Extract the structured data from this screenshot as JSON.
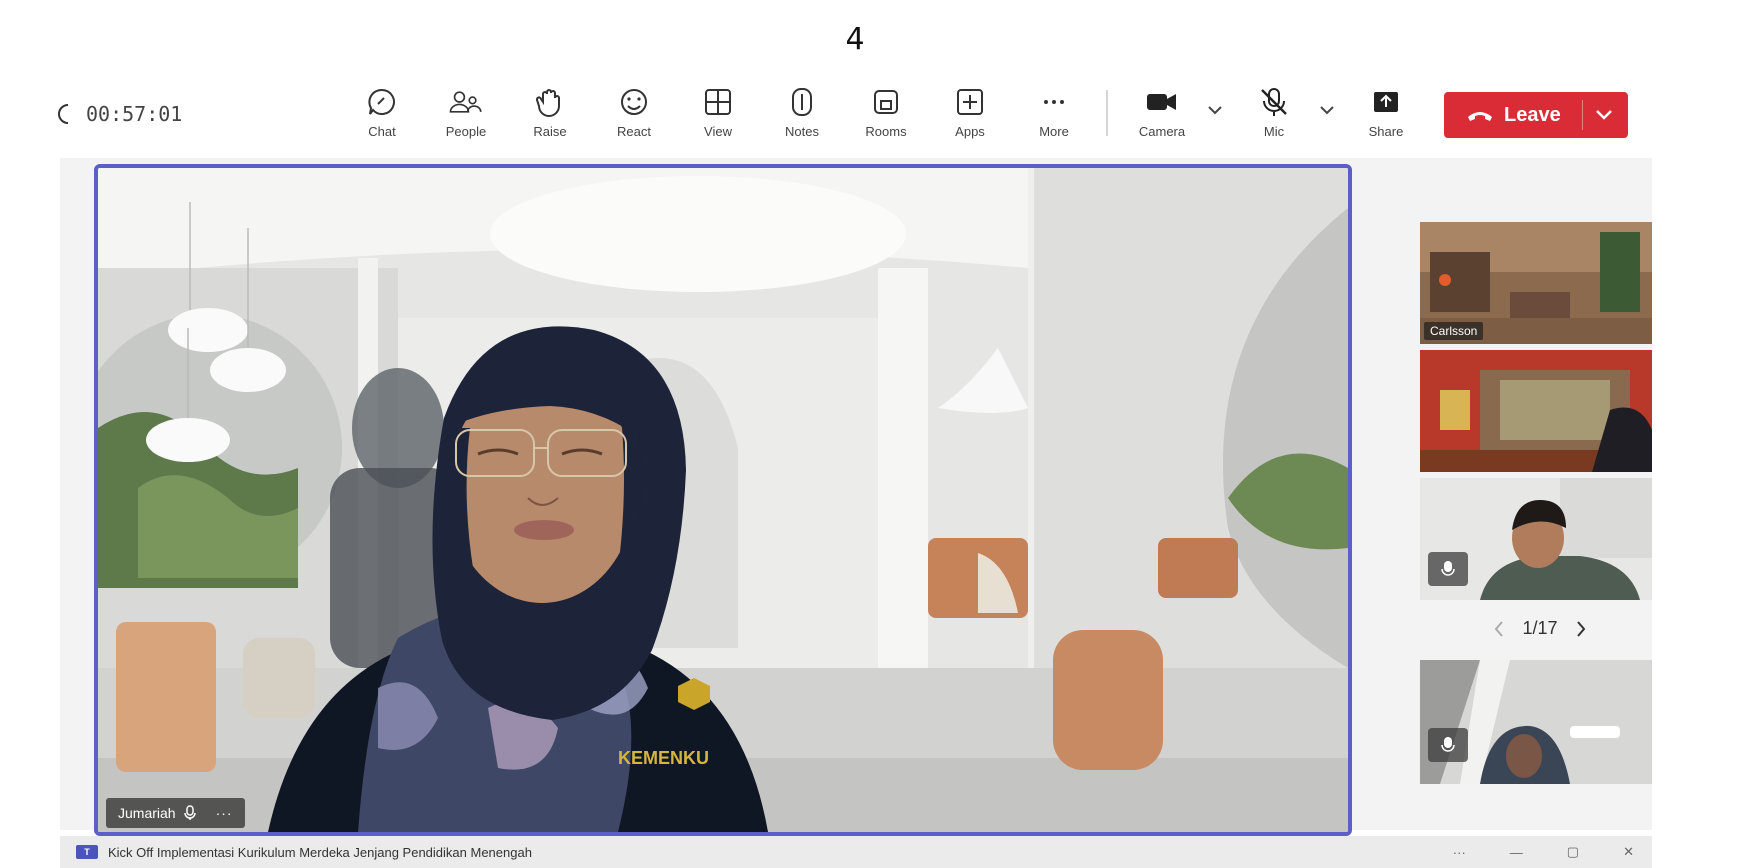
{
  "page_number": "4",
  "toolbar": {
    "timer": "00:57:01",
    "items": [
      {
        "label": "Chat",
        "icon": "chat-icon"
      },
      {
        "label": "People",
        "icon": "people-icon"
      },
      {
        "label": "Raise",
        "icon": "raise-hand-icon"
      },
      {
        "label": "React",
        "icon": "react-icon"
      },
      {
        "label": "View",
        "icon": "view-icon"
      },
      {
        "label": "Notes",
        "icon": "notes-icon"
      },
      {
        "label": "Rooms",
        "icon": "rooms-icon"
      },
      {
        "label": "Apps",
        "icon": "apps-icon"
      },
      {
        "label": "More",
        "icon": "more-icon"
      },
      {
        "label": "Camera",
        "icon": "camera-icon"
      },
      {
        "label": "Mic",
        "icon": "mic-off-icon"
      },
      {
        "label": "Share",
        "icon": "share-icon"
      }
    ],
    "leave_label": "Leave"
  },
  "main_video": {
    "participant_name": "Jumariah",
    "more_label": "···",
    "shirt_text": "KEMENKU"
  },
  "thumbnails": [
    {
      "label": "Carlsson"
    },
    {
      "label": ""
    },
    {
      "label": ""
    },
    {
      "label": ""
    }
  ],
  "pager": {
    "text": "1/17"
  },
  "statusbar": {
    "app_badge": "T",
    "title": "Kick Off Implementasi Kurikulum Merdeka Jenjang Pendidikan Menengah",
    "controls": [
      "···",
      "—",
      "▢",
      "✕"
    ]
  },
  "colors": {
    "accent": "#5b5fc7",
    "leave": "#d92c37"
  }
}
